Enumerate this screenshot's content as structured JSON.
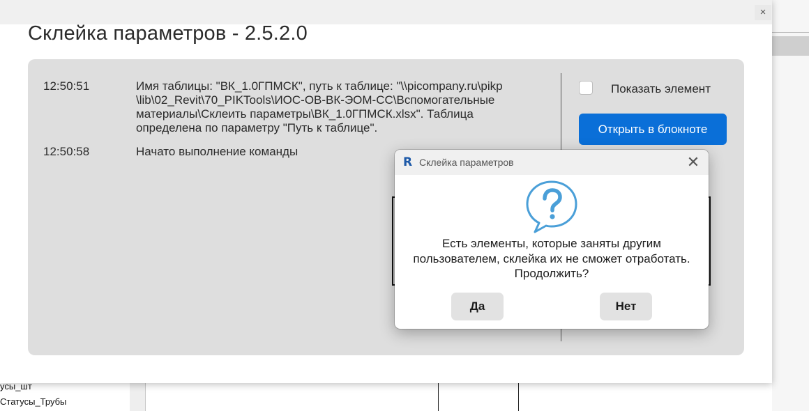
{
  "background": {
    "list_items": [
      "усы_шт",
      "Статусы_Трубы"
    ]
  },
  "main_window": {
    "close_glyph": "×",
    "title": "Склейка параметров - 2.5.2.0",
    "log": [
      {
        "time": "12:50:51",
        "lines": [
          "Имя таблицы: \"ВК_1.0ГПМСК\", путь к таблице: \"\\\\picompany.ru\\pikp",
          "\\lib\\02_Revit\\70_PIKTools\\ИОС-ОВ-ВК-ЭОМ-СС\\Вспомогательные",
          "материалы\\Склеить параметры\\ВК_1.0ГПМСК.xlsx\". Таблица",
          "определена по параметру \"Путь к таблице\"."
        ]
      },
      {
        "time": "12:50:58",
        "lines": [
          "Начато выполнение команды"
        ]
      }
    ],
    "show_element_label": "Показать элемент",
    "open_notepad_label": "Открыть в блокноте",
    "accent_color": "#0a6fd8"
  },
  "dialog": {
    "app_icon_glyph": "R",
    "title": "Склейка параметров",
    "close_glyph": "✕",
    "message_lines": [
      "Есть элементы, которые заняты другим",
      "пользователем, склейка их не сможет отработать.",
      "Продолжить?"
    ],
    "yes_label": "Да",
    "no_label": "Нет",
    "icon": "question-bubble-icon",
    "icon_color": "#4a9fd8"
  }
}
